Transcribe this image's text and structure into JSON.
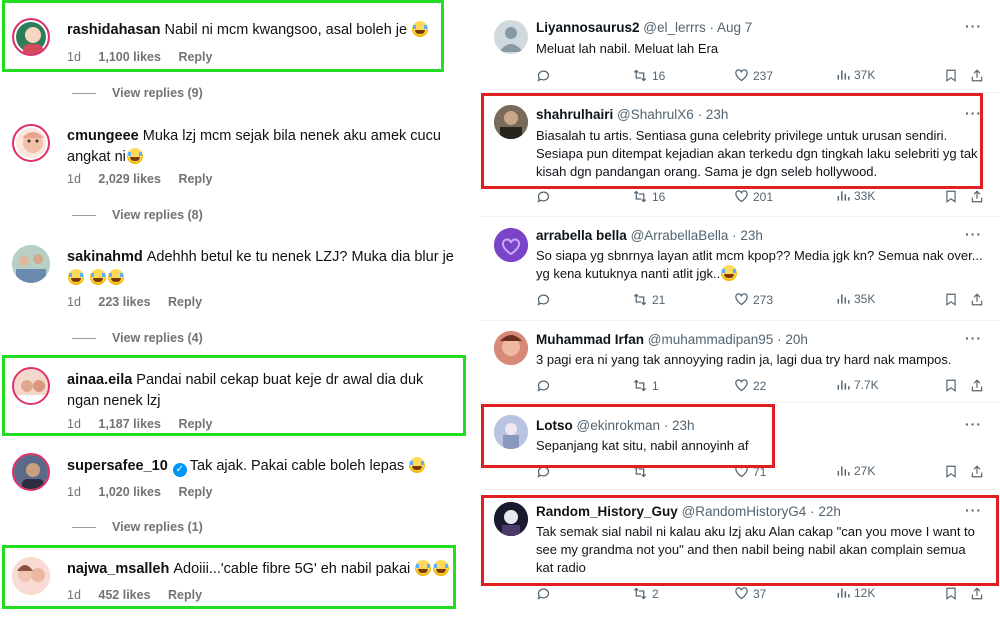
{
  "instagram": {
    "comments": [
      {
        "user": "rashidahasan",
        "text": "Nabil ni mcm kwangsoo, asal boleh je",
        "emojis": 1,
        "time": "1d",
        "likes": "1,100 likes",
        "reply": "Reply",
        "view_replies": "View replies (9)",
        "avatar_color": "#2e7d5a"
      },
      {
        "user": "cmungeee",
        "text": "Muka lzj mcm sejak bila nenek aku amek cucu angkat ni",
        "emojis": 1,
        "time": "1d",
        "likes": "2,029 likes",
        "reply": "Reply",
        "view_replies": "View replies (8)",
        "avatar_color": "#f3c9b8"
      },
      {
        "user": "sakinahmd",
        "text": "Adehhh betul ke tu nenek LZJ? Muka dia blur je",
        "emojis": 3,
        "time": "1d",
        "likes": "223 likes",
        "reply": "Reply",
        "view_replies": "View replies (4)",
        "avatar_color": "#9bb7a8"
      },
      {
        "user": "ainaa.eila",
        "text": "Pandai nabil cekap buat keje dr awal dia duk ngan nenek lzj",
        "emojis": 0,
        "time": "1d",
        "likes": "1,187 likes",
        "reply": "Reply",
        "view_replies": "",
        "avatar_color": "#c97a6a"
      },
      {
        "user": "supersafee_10",
        "text": "Tak ajak. Pakai cable boleh lepas",
        "emojis": 1,
        "time": "1d",
        "likes": "1,020 likes",
        "reply": "Reply",
        "view_replies": "View replies (1)",
        "avatar_color": "#4a5a7a"
      },
      {
        "user": "najwa_msalleh",
        "text": "Adoiii...'cable fibre 5G' eh nabil pakai",
        "emojis": 2,
        "time": "1d",
        "likes": "452 likes",
        "reply": "Reply",
        "view_replies": "",
        "avatar_color": "#e8b8a8"
      }
    ]
  },
  "twitter": {
    "posts": [
      {
        "name": "Liyannosaurus2",
        "handle": "@el_lerrrs",
        "time": "· Aug 7",
        "text": "Meluat lah nabil. Meluat lah Era",
        "retweets": "16",
        "likes": "237",
        "views": "37K",
        "avatar_color": "#cfd9de",
        "boxed": false
      },
      {
        "name": "shahrulhairi",
        "handle": "@ShahrulX6",
        "time": "· 23h",
        "text": "Biasalah tu artis. Sentiasa guna celebrity privilege untuk urusan sendiri. Sesiapa pun ditempat kejadian akan terkedu dgn tingkah laku selebriti yg tak kisah dgn pandangan orang. Sama je dgn seleb hollywood.",
        "retweets": "16",
        "likes": "201",
        "views": "33K",
        "avatar_color": "#6b5a4a",
        "boxed": true
      },
      {
        "name": "arrabella bella",
        "handle": "@ArrabellaBella",
        "time": "· 23h",
        "text": "So siapa yg sbnrnya layan atlit mcm kpop?? Media jgk kn? Semua nak over... yg kena kutuknya nanti atlit jgk..",
        "retweets": "21",
        "likes": "273",
        "views": "35K",
        "avatar_color": "#8a4fd0",
        "boxed": false
      },
      {
        "name": "Muhammad Irfan",
        "handle": "@muhammadipan95",
        "time": "· 20h",
        "text": "3 pagi era ni yang tak annoyying radin ja, lagi dua try hard nak mampos.",
        "retweets": "1",
        "likes": "22",
        "views": "7.7K",
        "avatar_color": "#c07a6a",
        "boxed": false
      },
      {
        "name": "Lotso",
        "handle": "@ekinrokman",
        "time": "· 23h",
        "text": "Sepanjang kat situ, nabil annoyinh af",
        "retweets": "",
        "likes": "71",
        "views": "27K",
        "avatar_color": "#9aa6c8",
        "boxed": true
      },
      {
        "name": "Random_History_Guy",
        "handle": "@RandomHistoryG4",
        "time": "· 22h",
        "text": "Tak semak sial nabil ni kalau aku lzj aku Alan cakap \"can you move I want to see my grandma not you\" and then nabil being nabil akan complain semua kat radio",
        "retweets": "2",
        "likes": "37",
        "views": "12K",
        "avatar_color": "#1a1a2e",
        "boxed": true
      }
    ]
  },
  "colors": {
    "green_highlight": "#22dd22",
    "red_highlight": "#e02020",
    "instagram_verified": "#0095f6"
  }
}
